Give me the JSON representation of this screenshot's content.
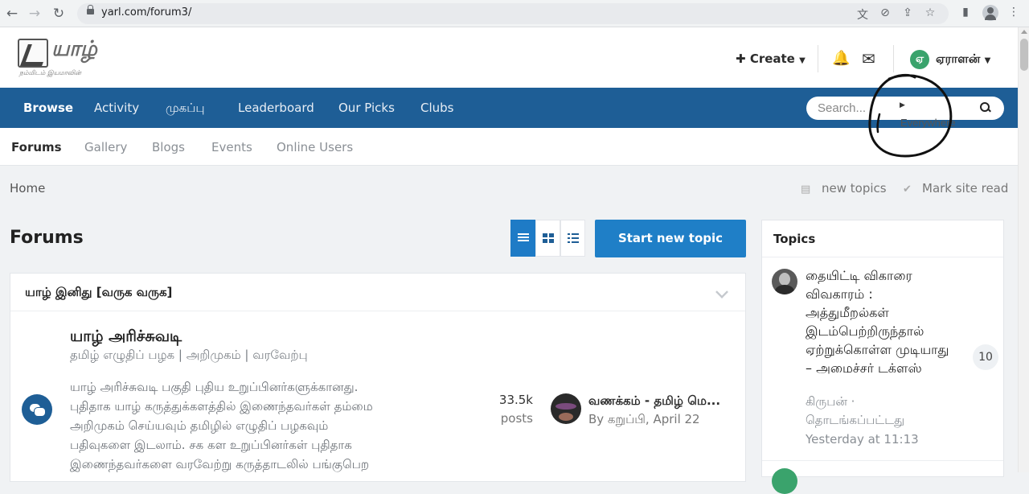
{
  "browser": {
    "url": "yarl.com/forum3/",
    "back": "←",
    "forward": "→",
    "reload": "↻"
  },
  "header": {
    "logo_word": "யாழ்",
    "logo_tagline": "நம்மிடம் இயமாவின்",
    "create_label": "Create",
    "username": "ஏராளன்",
    "user_initial": "ஏ"
  },
  "nav": {
    "tabs": [
      "Browse",
      "Activity",
      "முகப்பு",
      "Leaderboard",
      "Our Picks",
      "Clubs"
    ],
    "search_placeholder": "Search...",
    "search_scope": "Everywhere"
  },
  "subnav": {
    "tabs": [
      "Forums",
      "Gallery",
      "Blogs",
      "Events",
      "Online Users"
    ]
  },
  "breadcrumb": {
    "home": "Home",
    "new_topics": "new topics",
    "mark_read": "Mark site read"
  },
  "page": {
    "title": "Forums",
    "start_topic": "Start new topic"
  },
  "category": {
    "title": "யாழ் இனிது [வருக வருக]",
    "forum": {
      "name": "யாழ் அரிச்சுவடி",
      "sub": "தமிழ் எழுதிப் பழக | அறிமுகம் | வரவேற்பு",
      "desc_lines": [
        "யாழ் அரிச்சுவடி பகுதி புதிய உறுப்பினர்களுக்கானது.",
        "புதிதாக யாழ் கருத்துக்களத்தில் இணைந்தவர்கள் தம்மை",
        "அறிமுகம் செய்யவும் தமிழில் எழுதிப் பழகவும்",
        "பதிவுகளை இடலாம். சக கள உறுப்பினர்கள் புதிதாக",
        "இணைந்தவர்களை வரவேற்று கருத்தாடலில் பங்குபெற"
      ],
      "post_count": "33.5k",
      "post_label": "posts",
      "last_title": "வணக்கம் - தமிழ் மெ...",
      "last_by": "By கறுப்பி, April 22"
    }
  },
  "sidebar": {
    "title": "Topics",
    "topic": {
      "title": "தையிட்டி விகாரை விவகாரம் : அத்துமீறல்கள் இடம்பெற்றிருந்தால் ஏற்றுக்கொள்ள முடியாது – அமைச்சர் டக்ளஸ்",
      "author": "கிருபன் ·",
      "status": "தொடங்கப்பட்டது",
      "time": "Yesterday at 11:13",
      "replies": "10"
    }
  },
  "colors": {
    "nav_bg": "#1e5e96",
    "primary_button": "#1f7fc7",
    "avatar_green": "#3aa36c"
  }
}
